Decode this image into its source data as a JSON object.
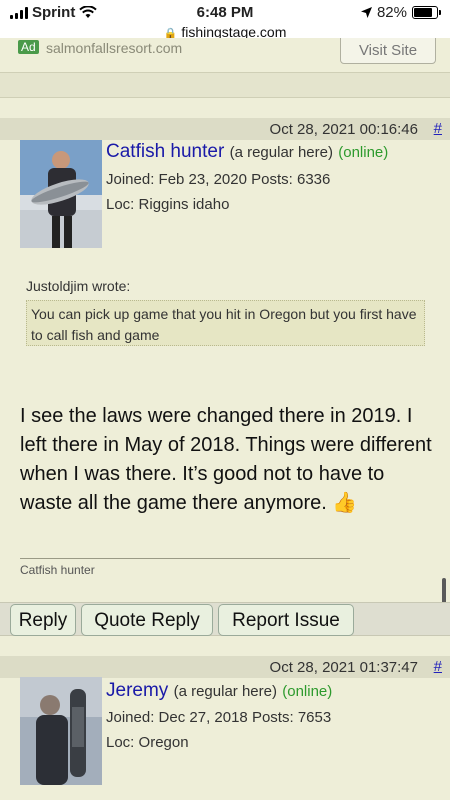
{
  "status_bar": {
    "carrier": "Sprint",
    "time": "6:48 PM",
    "battery_percent": "82%",
    "battery_level": 0.82,
    "icons": [
      "signal-icon",
      "wifi-icon",
      "location-arrow-icon",
      "battery-icon"
    ]
  },
  "browser": {
    "url": "fishingstage.com"
  },
  "ad": {
    "badge": "Ad",
    "domain": "salmonfallsresort.com",
    "button": "Visit Site"
  },
  "posts": [
    {
      "date": "Oct 28, 2021 00:16:46",
      "permalink": "#",
      "user": {
        "name": "Catfish hunter",
        "role": "(a regular here)",
        "status": "(online)",
        "joined_label": "Joined:",
        "joined": "Feb 23, 2020",
        "posts_label": "Posts:",
        "posts": "6336",
        "loc_label": "Loc:",
        "location": "Riggins idaho"
      },
      "quote": {
        "author": "Justoldjim wrote:",
        "text": "You can pick up game that you hit in Oregon but you first have to call fish and game"
      },
      "body": "I see the laws were changed there in 2019. I left there in May of 2018. Things were different when I was there. It’s good not to have to waste all the game there anymore.",
      "signature": "Catfish hunter"
    },
    {
      "date": "Oct 28, 2021 01:37:47",
      "permalink": "#",
      "user": {
        "name": "Jeremy",
        "role": "(a regular here)",
        "status": "(online)",
        "joined_label": "Joined:",
        "joined": "Dec 27, 2018",
        "posts_label": "Posts:",
        "posts": "7653",
        "loc_label": "Loc:",
        "location": "Oregon"
      }
    }
  ],
  "actions": {
    "reply": "Reply",
    "quote_reply": "Quote Reply",
    "report": "Report Issue"
  },
  "colors": {
    "page_bg": "#eeeed8",
    "username": "#1a1aa8",
    "online": "#2d9a2d",
    "header_bg": "#dcdcc6"
  }
}
